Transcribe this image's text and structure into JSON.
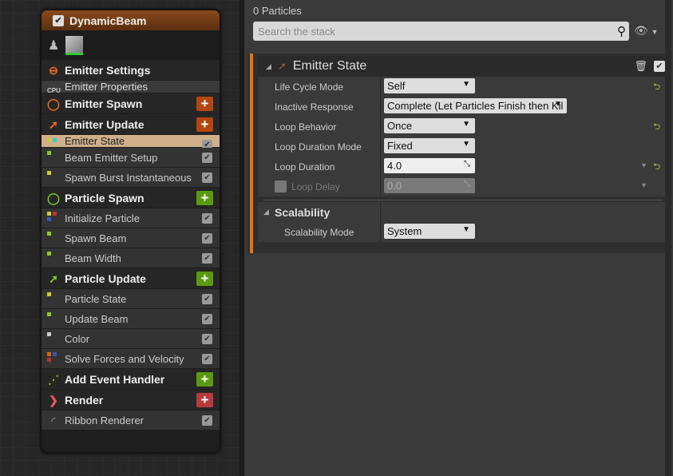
{
  "node": {
    "title": "DynamicBeam",
    "rows": [
      {
        "type": "hdr",
        "label": "Emitter Settings",
        "icon": "emitter-settings-icon",
        "glyph": "⊖",
        "color": "#f06a1a"
      },
      {
        "type": "props",
        "label": "Emitter Properties",
        "icon": "cpu-icon",
        "glyph": "CPU",
        "color": "#ccc"
      },
      {
        "type": "hdr",
        "label": "Emitter Spawn",
        "icon": "spawn-ring-icon",
        "glyph": "◯",
        "color": "#f06a1a",
        "plus": "#b4450e"
      },
      {
        "type": "hdr",
        "label": "Emitter Update",
        "icon": "update-arrow-icon",
        "glyph": "➚",
        "color": "#f06a1a",
        "plus": "#b4450e"
      },
      {
        "type": "sel",
        "label": "Emitter State",
        "dots": [
          "#cc3",
          "#3cc"
        ]
      },
      {
        "type": "item",
        "label": "Beam Emitter Setup",
        "dots": [
          "#8c2"
        ]
      },
      {
        "type": "item",
        "label": "Spawn Burst Instantaneous",
        "dots": [
          "#cc3"
        ]
      },
      {
        "type": "hdr",
        "label": "Particle Spawn",
        "icon": "spawn-ring-icon",
        "glyph": "◯",
        "color": "#7c2",
        "plus": "#5a9a10"
      },
      {
        "type": "item",
        "label": "Initialize Particle",
        "dots": [
          "#cc3",
          "#b33",
          "#35b"
        ]
      },
      {
        "type": "item",
        "label": "Spawn Beam",
        "dots": [
          "#8c2"
        ]
      },
      {
        "type": "item",
        "label": "Beam Width",
        "dots": [
          "#8c2"
        ]
      },
      {
        "type": "hdr",
        "label": "Particle Update",
        "icon": "update-arrow-icon",
        "glyph": "➚",
        "color": "#7c2",
        "plus": "#5a9a10"
      },
      {
        "type": "item",
        "label": "Particle State",
        "dots": [
          "#cc3"
        ]
      },
      {
        "type": "item",
        "label": "Update Beam",
        "dots": [
          "#8c2"
        ]
      },
      {
        "type": "item",
        "label": "Color",
        "dots": [
          "#ccc"
        ]
      },
      {
        "type": "item",
        "label": "Solve Forces and Velocity",
        "dots": [
          "#d60",
          "#35b",
          "#b33"
        ]
      },
      {
        "type": "hdr",
        "label": "Add Event Handler",
        "icon": "event-signal-icon",
        "glyph": "⋰",
        "color": "#7c2",
        "plus": "#5a9a10"
      },
      {
        "type": "hdr",
        "label": "Render",
        "icon": "render-icon",
        "glyph": "❯",
        "color": "#e55",
        "plus": "#b83a3a"
      },
      {
        "type": "item",
        "label": "Ribbon Renderer",
        "icon": "ribbon-icon",
        "glyph": "◜",
        "color": "#aaa"
      }
    ]
  },
  "panel": {
    "particle_count": "0 Particles",
    "search_placeholder": "Search the stack",
    "section_title": "Emitter State",
    "properties": [
      {
        "label": "Life Cycle Mode",
        "value": "Self",
        "reset": true
      },
      {
        "label": "Inactive Response",
        "value": "Complete (Let Particles Finish then Kil",
        "wide": true
      },
      {
        "label": "Loop Behavior",
        "value": "Once",
        "reset": true
      },
      {
        "label": "Loop Duration Mode",
        "value": "Fixed"
      },
      {
        "label": "Loop Duration",
        "value": "4.0",
        "numeric": true,
        "reset": true
      },
      {
        "label": "Loop Delay",
        "value": "0.0",
        "numeric": true,
        "disabled": true
      }
    ],
    "scalability": {
      "title": "Scalability",
      "label": "Scalability Mode",
      "value": "System"
    }
  }
}
